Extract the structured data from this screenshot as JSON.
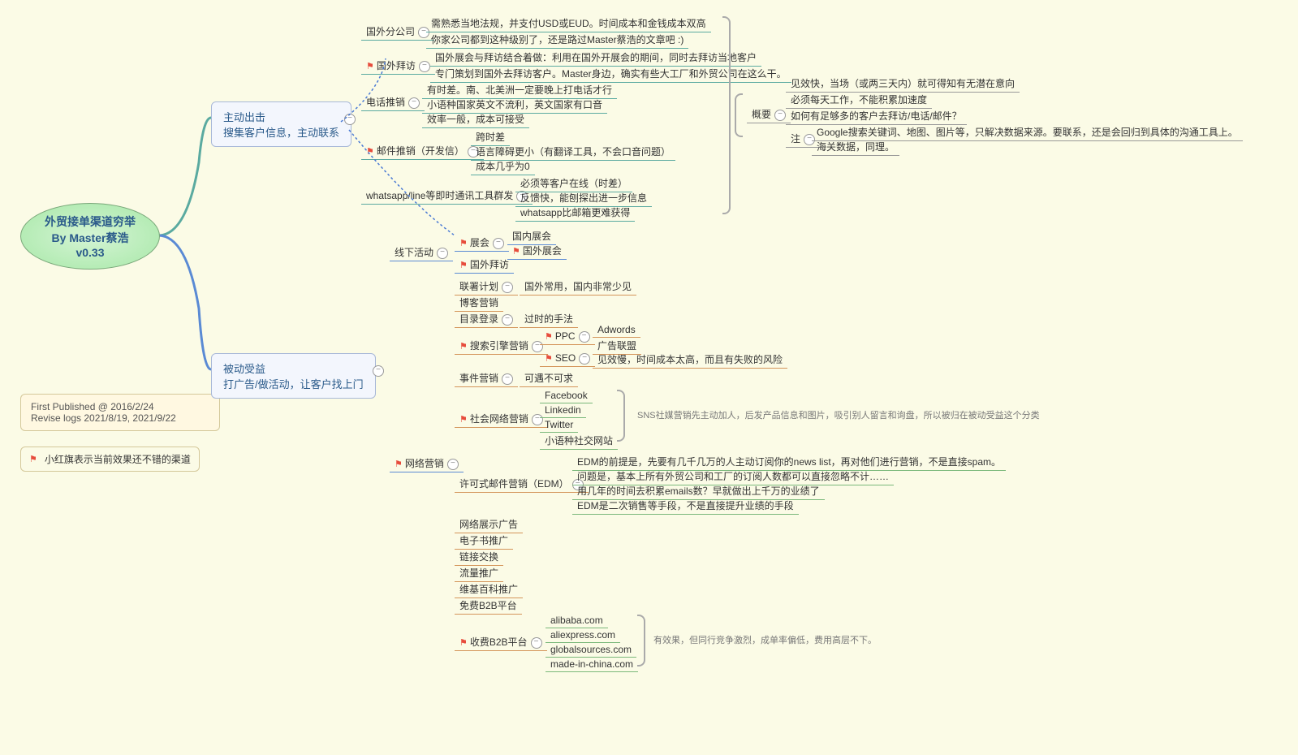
{
  "root": {
    "line1": "外贸接单渠道穷举",
    "line2": "By Master蔡浩",
    "line3": "v0.33"
  },
  "sticky": {
    "line1": "First Published @ 2016/2/24",
    "line2": "Revise logs 2021/8/19, 2021/9/22"
  },
  "legend": "小红旗表示当前效果还不错的渠道",
  "branch1": {
    "title": "主动出击",
    "sub": "搜集客户信息，主动联系"
  },
  "branch2": {
    "title": "被动受益",
    "sub": "打广告/做活动，让客户找上门"
  },
  "b1": {
    "n1": "国外分公司",
    "n1a": "需熟悉当地法规，并支付USD或EUD。时间成本和金钱成本双高",
    "n1b": "你家公司都到这种级别了，还是路过Master蔡浩的文章吧 :)",
    "n2": "国外拜访",
    "n2a": "国外展会与拜访结合着做：利用在国外开展会的期间，同时去拜访当地客户",
    "n2b": "专门策划到国外去拜访客户。Master身边，确实有些大工厂和外贸公司在这么干。",
    "n3": "电话推销",
    "n3a": "有时差。南、北美洲一定要晚上打电话才行",
    "n3b": "小语种国家英文不流利，英文国家有口音",
    "n3c": "效率一般，成本可接受",
    "n4": "邮件推销（开发信）",
    "n4a": "跨时差",
    "n4b": "语言障碍更小（有翻译工具，不会口音问题）",
    "n4c": "成本几乎为0",
    "n5": "whatsapp/line等即时通讯工具群发",
    "n5a": "必须等客户在线（时差）",
    "n5b": "反馈快，能刨探出进一步信息",
    "n5c": "whatsapp比邮箱更难获得"
  },
  "summary": {
    "title": "概要",
    "s1": "见效快，当场（或两三天内）就可得知有无潜在意向",
    "s2": "必须每天工作，不能积累加速度",
    "s3": "如何有足够多的客户去拜访/电话/邮件？",
    "note": "注",
    "s4": "Google搜索关键词、地图、图片等，只解决数据来源。要联系，还是会回归到具体的沟通工具上。",
    "s5": "海关数据，同理。"
  },
  "b2": {
    "off": "线下活动",
    "off1": "展会",
    "off1a": "国内展会",
    "off1b": "国外展会",
    "off2": "国外拜访",
    "net": "网络营销",
    "aff": "联署计划",
    "aff_n": "国外常用，国内非常少见",
    "blog": "博客营销",
    "dir": "目录登录",
    "dir_n": "过时的手法",
    "sem": "搜索引擎营销",
    "ppc": "PPC",
    "ppc1": "Adwords",
    "ppc2": "广告联盟",
    "seo": "SEO",
    "seo_n": "见效慢，时间成本太高，而且有失败的风险",
    "evt": "事件营销",
    "evt_n": "可遇不可求",
    "sns": "社会网络营销",
    "sns1": "Facebook",
    "sns2": "Linkedin",
    "sns3": "Twitter",
    "sns4": "小语种社交网站",
    "sns_note": "SNS社媒营销先主动加人，后发产品信息和图片，吸引别人留言和询盘，所以被归在被动受益这个分类",
    "edm": "许可式邮件营销（EDM）",
    "edm1": "EDM的前提是，先要有几千几万的人主动订阅你的news list，再对他们进行营销，不是直接spam。",
    "edm2": "问题是，基本上所有外贸公司和工厂的订阅人数都可以直接忽略不计……",
    "edm3": "用几年的时间去积累emails数？早就做出上千万的业绩了",
    "edm4": "EDM是二次销售等手段，不是直接提升业绩的手段",
    "disp": "网络展示广告",
    "ebook": "电子书推广",
    "link": "链接交换",
    "traffic": "流量推广",
    "wiki": "维基百科推广",
    "freeb2b": "免费B2B平台",
    "paidb2b": "收费B2B平台",
    "pb1": "alibaba.com",
    "pb2": "aliexpress.com",
    "pb3": "globalsources.com",
    "pb4": "made-in-china.com",
    "pb_note": "有效果，但同行竞争激烈，成单率偏低，费用高层不下。"
  }
}
